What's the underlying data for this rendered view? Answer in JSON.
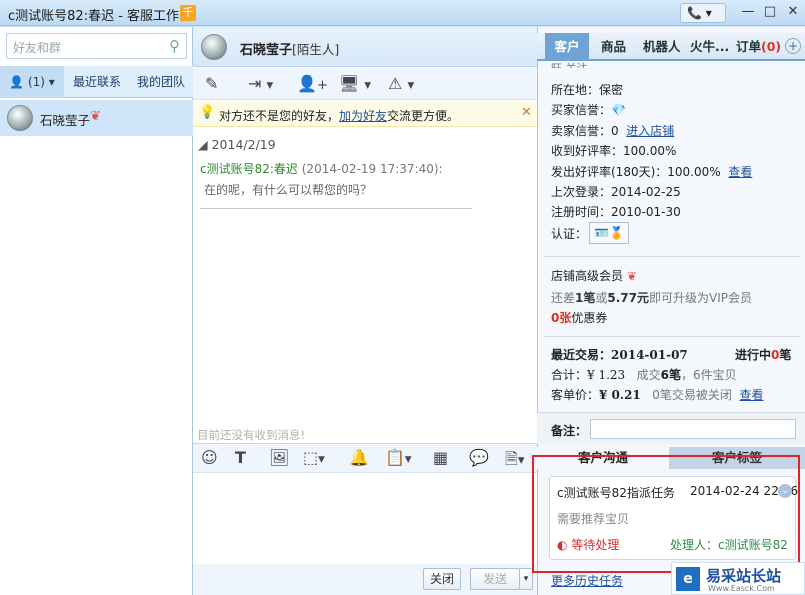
{
  "window": {
    "title": "c测试账号82:春迟 - 客服工作台",
    "title_badge": "千",
    "phone_icon": "📞",
    "controls": {
      "min": "—",
      "max": "□",
      "close": "✕",
      "menu": "▾"
    }
  },
  "left": {
    "search_placeholder": "好友和群",
    "tabs": {
      "group_count": "(1)",
      "recent": "最近联系",
      "team": "我的团队"
    },
    "contacts": [
      {
        "name": "石晓莹子"
      }
    ]
  },
  "chat": {
    "contact_name": "石晓莹子",
    "contact_status": "[陌生人]",
    "notice_prefix": "对方还不是您的好友，",
    "notice_link": "加为好友",
    "notice_suffix": "交流更方便。",
    "date": "2014/2/19",
    "messages": [
      {
        "sender": "c测试账号82:春迟",
        "time": "(2014-02-19 17:37:40):",
        "text": "在的呢，有什么可以帮您的吗？"
      }
    ],
    "no_messages_hint": "目前还没有收到消息!",
    "buttons": {
      "close": "关闭",
      "send": "发送"
    }
  },
  "right": {
    "tabs": [
      "客户",
      "商品",
      "机器人",
      "火牛...",
      "订单"
    ],
    "order_badge": "(0)",
    "partial_top": "旺 关注 ——",
    "info": [
      {
        "label": "所在地：",
        "value": "保密"
      },
      {
        "label": "买家信誉：",
        "value": "💎"
      },
      {
        "label": "卖家信誉：",
        "value": "0",
        "link": "进入店铺"
      },
      {
        "label": "收到好评率：",
        "value": "100.00%"
      },
      {
        "label": "发出好评率(180天)：",
        "value": "100.00%",
        "link": "查看"
      },
      {
        "label": "上次登录：",
        "value": "2014-02-25"
      },
      {
        "label": "注册时间：",
        "value": "2010-01-30"
      },
      {
        "label": "认证：",
        "value": ""
      }
    ],
    "member": {
      "level": "店铺高级会员",
      "upgrade_pre": "还差",
      "upgrade_count": "1笔",
      "upgrade_mid": "或",
      "upgrade_amount": "5.77元",
      "upgrade_post": "即可升级为VIP会员",
      "coupon_count": "0张",
      "coupon_label": "优惠券"
    },
    "trade": {
      "recent_label": "最近交易：",
      "recent_date": "2014-01-07",
      "in_progress_pre": "进行中",
      "in_progress_count": "0",
      "in_progress_post": "笔",
      "total_label": "合计：",
      "total_value": "¥ 1.23",
      "total_detail_a": "成交",
      "total_count": "6笔",
      "total_detail_b": "，",
      "total_items": "6件宝贝",
      "avg_label": "客单价：",
      "avg_value": "¥ 0.21",
      "avg_closed": "0笔交易被关闭",
      "avg_link": "查看"
    },
    "remark_label": "备注：",
    "subtabs": [
      "客户沟通",
      "客户标签"
    ],
    "task": {
      "title": "c测试账号82指派任务",
      "time": "2014-02-24 22:46",
      "desc": "需要推荐宝贝",
      "status": "等待处理",
      "handler_label": "处理人：",
      "handler": "c测试账号82"
    },
    "history_link": "更多历史任务"
  },
  "watermark": {
    "brand": "易采站长站",
    "sub": "Www.Easck.Com"
  }
}
